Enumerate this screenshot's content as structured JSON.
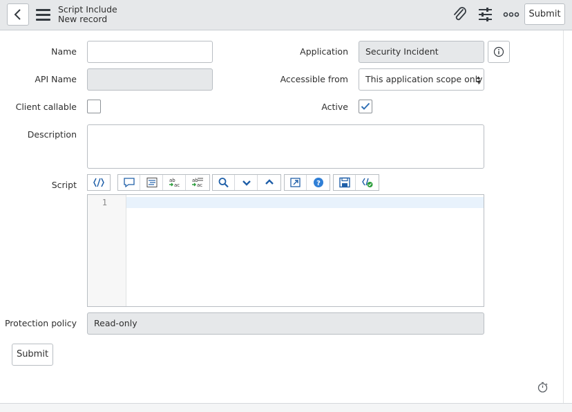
{
  "header": {
    "title": "Script Include",
    "subtitle": "New record",
    "submit_label": "Submit",
    "icons": [
      "back-icon",
      "hamburger-menu-icon",
      "paperclip-icon",
      "sliders-icon",
      "more-options-icon"
    ]
  },
  "form": {
    "name": {
      "label": "Name",
      "value": ""
    },
    "api_name": {
      "label": "API Name",
      "value": ""
    },
    "client_callable": {
      "label": "Client callable",
      "checked": false
    },
    "description": {
      "label": "Description",
      "value": ""
    },
    "application": {
      "label": "Application",
      "value": "Security Incident"
    },
    "accessible_from": {
      "label": "Accessible from",
      "value": "This application scope only"
    },
    "active": {
      "label": "Active",
      "checked": true
    },
    "script": {
      "label": "Script",
      "line_numbers": [
        "1"
      ],
      "toolbar_icons": [
        "toggle-syntax-icon",
        "comment-icon",
        "format-code-icon",
        "replace-icon",
        "replace-all-icon",
        "search-icon",
        "next-match-icon",
        "previous-match-icon",
        "fullscreen-icon",
        "help-icon",
        "save-icon",
        "script-debug-icon"
      ]
    },
    "protection_policy": {
      "label": "Protection policy",
      "value": "Read-only"
    },
    "submit_label": "Submit"
  },
  "colors": {
    "header_bg": "#e6e8ea",
    "readonly_bg": "#e6e8ea",
    "accent_blue": "#1f5fa8",
    "check_blue": "#2f6fb5"
  }
}
